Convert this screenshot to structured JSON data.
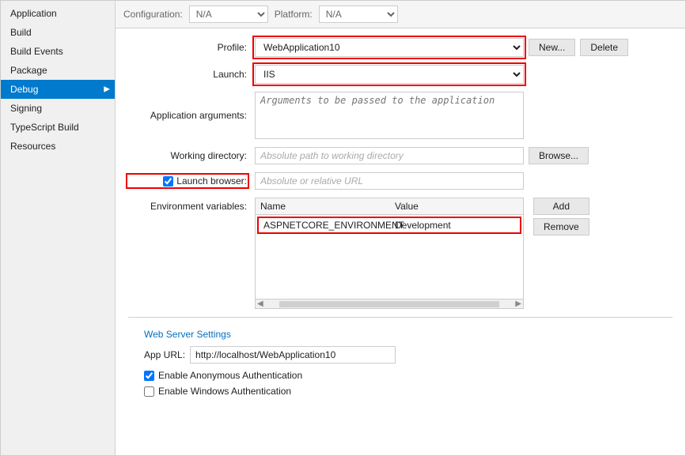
{
  "sidebar": {
    "items": [
      {
        "label": "Application",
        "active": false
      },
      {
        "label": "Build",
        "active": false
      },
      {
        "label": "Build Events",
        "active": false
      },
      {
        "label": "Package",
        "active": false
      },
      {
        "label": "Debug",
        "active": true
      },
      {
        "label": "Signing",
        "active": false
      },
      {
        "label": "TypeScript Build",
        "active": false
      },
      {
        "label": "Resources",
        "active": false
      }
    ]
  },
  "topbar": {
    "configuration_label": "Configuration:",
    "configuration_value": "N/A",
    "platform_label": "Platform:",
    "platform_value": "N/A"
  },
  "form": {
    "profile_label": "Profile:",
    "profile_value": "WebApplication10",
    "new_button": "New...",
    "delete_button": "Delete",
    "launch_label": "Launch:",
    "launch_value": "IIS",
    "app_arguments_label": "Application arguments:",
    "app_arguments_placeholder": "Arguments to be passed to the application",
    "working_dir_label": "Working directory:",
    "working_dir_placeholder": "Absolute path to working directory",
    "browse_button": "Browse...",
    "launch_browser_label": "Launch browser:",
    "launch_browser_url_placeholder": "Absolute or relative URL",
    "launch_browser_checked": true,
    "env_vars_label": "Environment variables:",
    "env_vars_col_name": "Name",
    "env_vars_col_value": "Value",
    "env_vars_row_name": "ASPNETCORE_ENVIRONMENT",
    "env_vars_row_value": "Development",
    "add_button": "Add",
    "remove_button": "Remove"
  },
  "web_server": {
    "section_label": "Web Server Settings",
    "app_url_label": "App URL:",
    "app_url_value": "http://localhost/WebApplication10",
    "anon_auth_label": "Enable Anonymous Authentication",
    "anon_auth_checked": true,
    "windows_auth_label": "Enable Windows Authentication",
    "windows_auth_checked": false
  }
}
